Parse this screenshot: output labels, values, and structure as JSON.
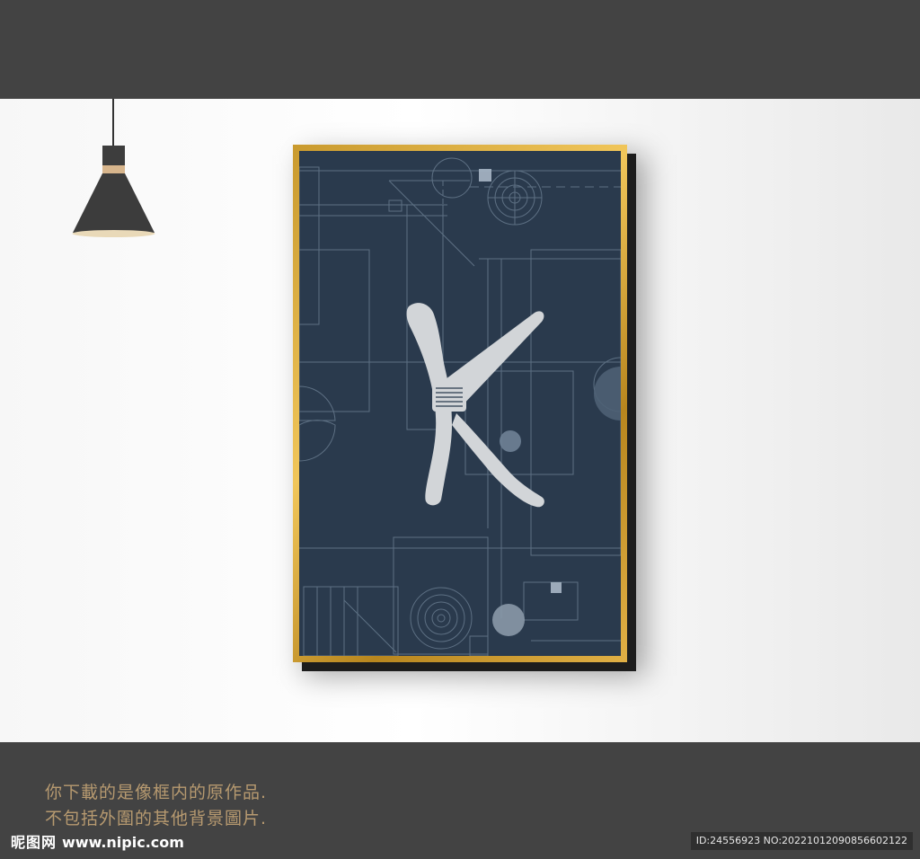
{
  "scene": {
    "colors": {
      "outer_background": "#434343",
      "wall": "#f7f7f7",
      "frame_gold": "#d9a93a",
      "canvas_navy": "#2a3a4d",
      "line_art": "#6f8296",
      "letter": "#d2d5d8",
      "caption": "#b79a70"
    }
  },
  "artwork": {
    "letter": "K",
    "letter_icon": "stylized-k-letter-icon"
  },
  "caption": {
    "line1": "你下載的是像框内的原作品.",
    "line2": "不包括外圍的其他背景圖片."
  },
  "watermark": {
    "logo_cn": "昵图网",
    "logo_url": "www.nipic.com",
    "id_text": "ID:24556923 NO:20221012090856602122"
  }
}
